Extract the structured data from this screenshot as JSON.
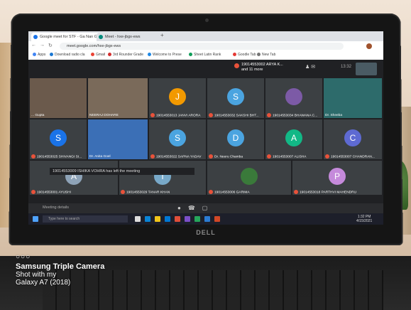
{
  "browser": {
    "tabs": [
      {
        "label": "Google meet for STF - Ga Nan G",
        "color": "#1a73e8"
      },
      {
        "label": "Meet - hxe-jbgx-ews",
        "color": "#00897b"
      }
    ],
    "url": "meet.google.com/hxe-jbgx-ews",
    "bookmarks": [
      {
        "label": "Apps",
        "color": "#4285f4"
      },
      {
        "label": "Download radio cla",
        "color": "#1976d2"
      },
      {
        "label": "Gmail",
        "color": "#ea4335"
      },
      {
        "label": "3rd Rounder Grade",
        "color": "#d32f2f"
      },
      {
        "label": "Welcome to Prese",
        "color": "#1e88e5"
      },
      {
        "label": "Sheet Latin Rank",
        "color": "#0f9d58"
      },
      {
        "label": "Goodle Tab",
        "color": "#e53935"
      },
      {
        "label": "New Tab",
        "color": "#757575"
      }
    ]
  },
  "meet": {
    "banner": {
      "line1": "19014553002 ARYA K...",
      "line2": "and 11 more"
    },
    "time": "13:32",
    "participants": [
      {
        "name": "... Gupta",
        "initial": "",
        "color": "#5a4a3e"
      },
      {
        "name": "NEERAJ DOHARE",
        "initial": "",
        "color": "#6b5a4a"
      },
      {
        "name": "19014553013 JANVI ARORA",
        "initial": "J",
        "color": "#f29900"
      },
      {
        "name": "19014553032 SAKSHI BHT...",
        "initial": "S",
        "color": "#4ba4e0"
      },
      {
        "name": "19014553034 BHAWANA C...",
        "initial": "",
        "color": "#7c5aa6"
      },
      {
        "name": "Dr. Sheeba",
        "initial": "",
        "color": "#2d6b6b"
      },
      {
        "name": "19014553025 SHIVANGI SI...",
        "initial": "S",
        "color": "#1a73e8"
      },
      {
        "name": "Dr. Anita Goel",
        "initial": "",
        "color": "#3b6fb6"
      },
      {
        "name": "19014553022 SAPNA YADAV",
        "initial": "S",
        "color": "#4ba4e0"
      },
      {
        "name": "Dr. Neeru Chamba",
        "initial": "D",
        "color": "#4ba4e0"
      },
      {
        "name": "19014553007 ALISHA",
        "initial": "A",
        "color": "#12b886"
      },
      {
        "name": "19014553007 CHANDRAN...",
        "initial": "C",
        "color": "#5e6ad2"
      },
      {
        "name": "19014553001 AYUSHI",
        "initial": "A",
        "color": "#8ea3b8"
      },
      {
        "name": "19014553029 TANAR KHAN",
        "initial": "T",
        "color": "#78a9c9"
      },
      {
        "name": "19014553006 GARIMA",
        "initial": "",
        "color": "#3a7a3a"
      },
      {
        "name": "19014553018 PARTHVI MAHENDRU",
        "initial": "P",
        "color": "#c58adb"
      }
    ],
    "toast": "19014553009 ISHIKA VOHRA has left the meeting",
    "meeting_details": "Meeting details"
  },
  "taskbar": {
    "search": "Type here to search",
    "time": "1:32 PM",
    "date": "4/15/2021"
  },
  "laptop": {
    "brand": "DELL"
  },
  "watermark": {
    "logo": "○○○",
    "title": "Samsung Triple Camera",
    "line1": "Shot with my",
    "line2": "Galaxy A7 (2018)"
  }
}
